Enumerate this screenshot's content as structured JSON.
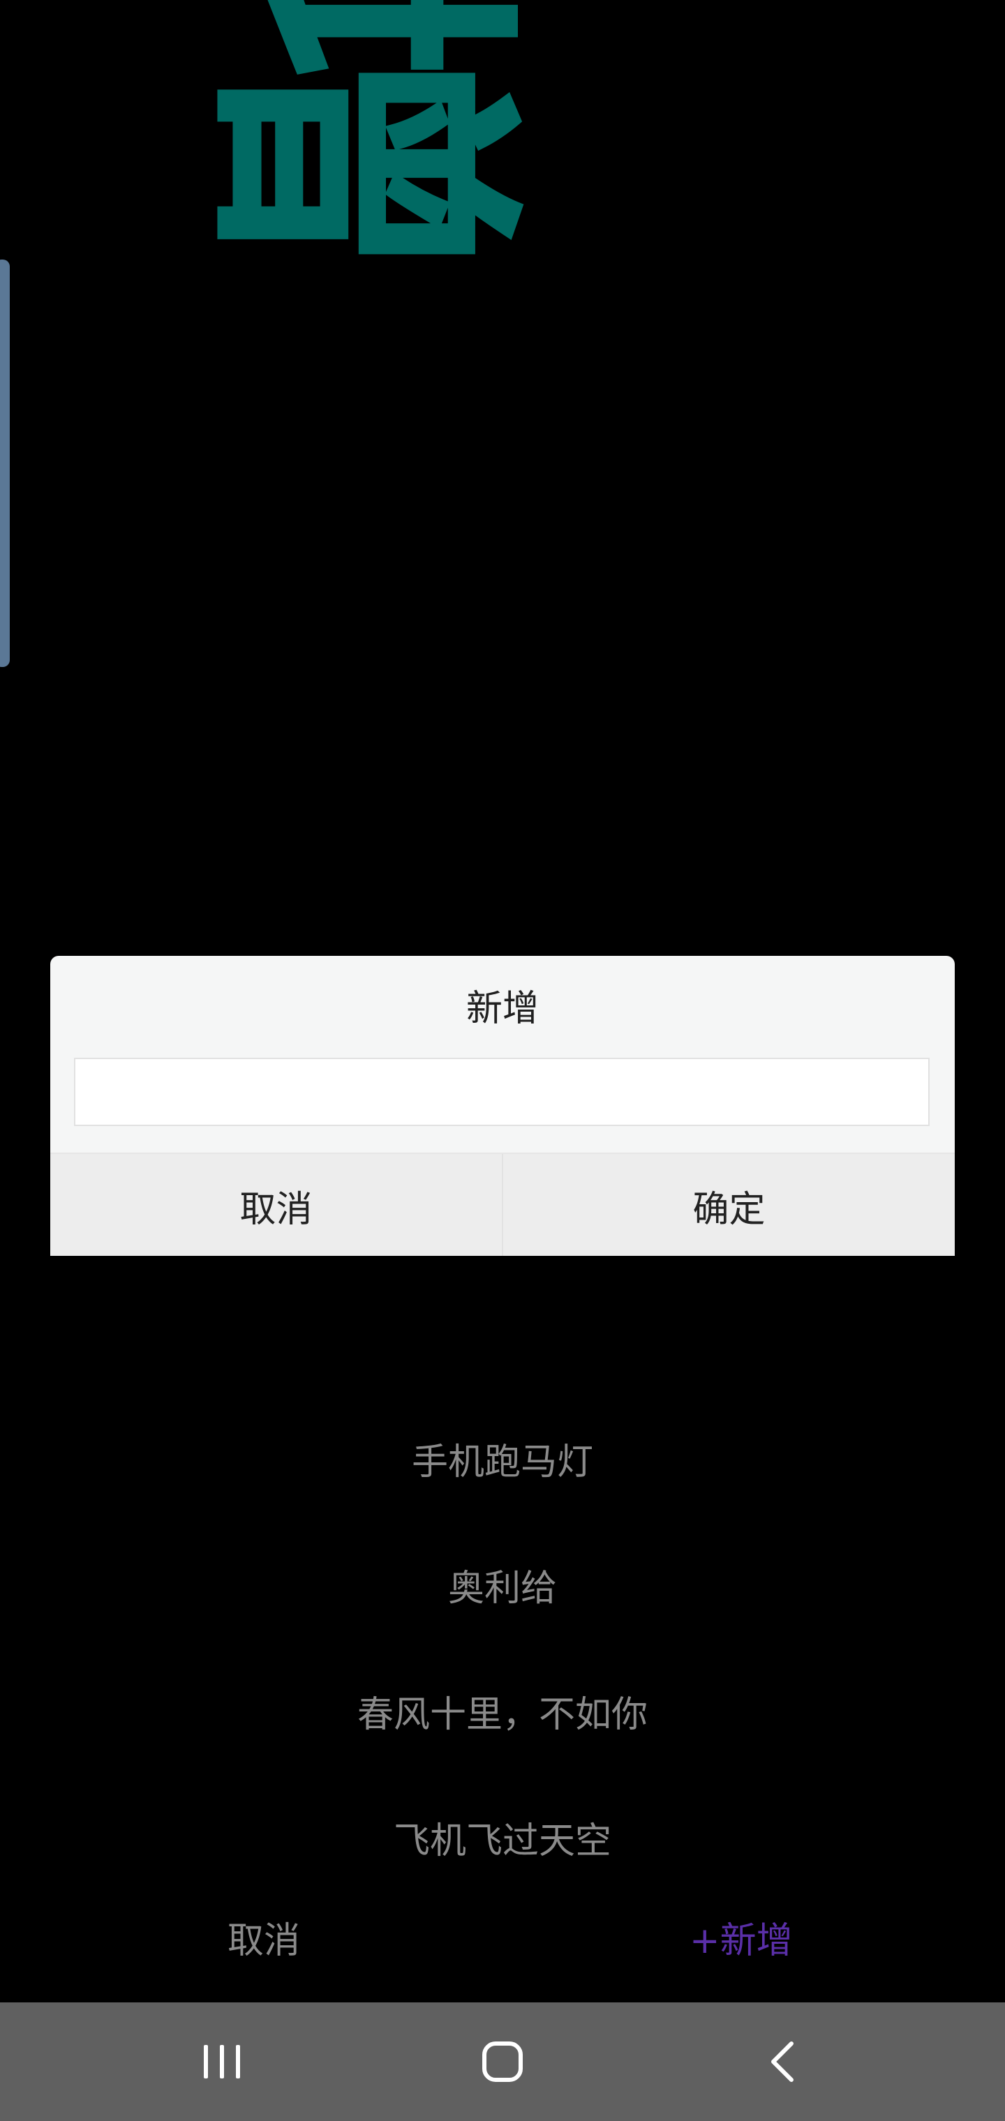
{
  "marquee": {
    "text": "新增",
    "color": "#006a63"
  },
  "dialog": {
    "title": "新增",
    "input_value": "",
    "cancel_label": "取消",
    "confirm_label": "确定"
  },
  "picker": {
    "items": [
      "手机跑马灯",
      "奥利给",
      "春风十里，不如你",
      "飞机飞过天空"
    ]
  },
  "actions": {
    "cancel_label": "取消",
    "add_label": "+新增",
    "add_color": "#5a2fa8"
  },
  "navbar": {
    "recents_icon": "recents-icon",
    "home_icon": "home-icon",
    "back_icon": "back-icon"
  }
}
